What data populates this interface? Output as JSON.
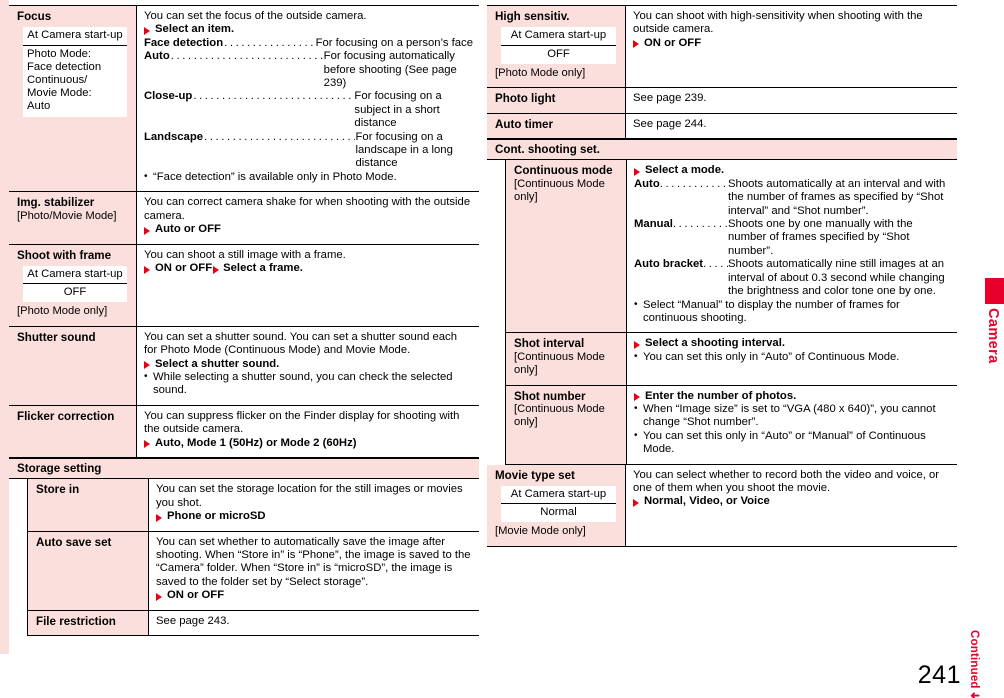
{
  "page": {
    "number": "241",
    "continued_label": "Continued",
    "continued_arrow": "➜",
    "side_tab_label": "Camera"
  },
  "labels": {
    "at_camera_startup": "At Camera start-up",
    "dots": "...................................................."
  },
  "left_column": {
    "rows": [
      {
        "name": "Focus",
        "defbox": {
          "title": "At Camera start-up",
          "value": "Photo Mode:\nFace detection\nContinuous/\nMovie Mode:\nAuto",
          "align": "left"
        },
        "intro": "You can set the focus of the outside camera.",
        "action": "Select an item.",
        "items": [
          {
            "term": "Face detection",
            "def": "For focusing on a person’s face"
          },
          {
            "term": "Auto",
            "def": "For focusing automatically before shooting (See page 239)"
          },
          {
            "term": "Close-up",
            "def": "For focusing on a subject in a short distance"
          },
          {
            "term": "Landscape",
            "def": "For focusing on a landscape in a long distance"
          }
        ],
        "bullets": [
          "“Face detection” is available only in Photo Mode."
        ]
      },
      {
        "name": "Img. stabilizer",
        "sub": "[Photo/Movie Mode]",
        "intro": "You can correct camera shake for when shooting with the outside camera.",
        "action": "Auto or OFF"
      },
      {
        "name": "Shoot with frame",
        "defbox": {
          "title": "At Camera start-up",
          "value": "OFF",
          "align": "center"
        },
        "sub": "[Photo Mode only]",
        "intro": "You can shoot a still image with a frame.",
        "action": "ON or OFF",
        "action2": "Select a frame."
      },
      {
        "name": "Shutter sound",
        "intro": "You can set a shutter sound. You can set a shutter sound each for Photo Mode (Continuous Mode) and Movie Mode.",
        "action": "Select a shutter sound.",
        "bullets": [
          "While selecting a shutter sound, you can check the selected sound."
        ]
      },
      {
        "name": "Flicker correction",
        "intro": "You can suppress flicker on the Finder display for shooting with the outside camera.",
        "action": "Auto, Mode 1 (50Hz) or Mode 2 (60Hz)"
      }
    ],
    "section": {
      "title": "Storage setting",
      "rows": [
        {
          "name": "Store in",
          "intro": "You can set the storage location for the still images or movies you shot.",
          "action": "Phone or microSD"
        },
        {
          "name": "Auto save set",
          "intro": "You can set whether to automatically save the image after shooting. When “Store in” is “Phone”, the image is saved to the “Camera” folder. When “Store in” is “microSD”, the image is saved to the folder set by “Select storage”.",
          "action": "ON or OFF"
        },
        {
          "name": "File restriction",
          "intro": "See page 243."
        }
      ]
    }
  },
  "right_column": {
    "rows": [
      {
        "name": "High sensitiv.",
        "defbox": {
          "title": "At Camera start-up",
          "value": "OFF",
          "align": "center"
        },
        "sub": "[Photo Mode only]",
        "intro": "You can shoot with high-sensitivity when shooting with the outside camera.",
        "action": "ON or OFF"
      },
      {
        "name": "Photo light",
        "intro": "See page 239."
      },
      {
        "name": "Auto timer",
        "intro": "See page 244."
      }
    ],
    "section": {
      "title": "Cont. shooting set.",
      "rows": [
        {
          "name": "Continuous mode",
          "sub": "[Continuous Mode only]",
          "action": "Select a mode.",
          "items": [
            {
              "term": "Auto",
              "def": "Shoots automatically at an interval and with the number of frames as specified by “Shot interval” and “Shot number”."
            },
            {
              "term": "Manual",
              "def": "Shoots one by one manually with the number of frames specified by “Shot number”."
            },
            {
              "term": "Auto bracket",
              "def": "Shoots automatically nine still images at an interval of about 0.3 second while changing the brightness and color tone one by one."
            }
          ],
          "bullets": [
            "Select “Manual” to display the number of frames for continuous shooting."
          ]
        },
        {
          "name": "Shot interval",
          "sub": "[Continuous Mode only]",
          "action": "Select a shooting interval.",
          "bullets": [
            "You can set this only in “Auto” of Continuous Mode."
          ]
        },
        {
          "name": "Shot number",
          "sub": "[Continuous Mode only]",
          "action": "Enter the number of photos.",
          "bullets": [
            "When “Image size” is set to “VGA (480 x 640)”, you cannot change “Shot number”.",
            "You can set this only in “Auto” or “Manual” of Continuous Mode."
          ]
        }
      ]
    },
    "trailing_rows": [
      {
        "name": "Movie type set",
        "defbox": {
          "title": "At Camera start-up",
          "value": "Normal",
          "align": "center"
        },
        "sub": "[Movie Mode only]",
        "intro": "You can select whether to record both the video and voice, or one of them when you shoot the movie.",
        "action": "Normal, Video, or Voice"
      }
    ]
  }
}
